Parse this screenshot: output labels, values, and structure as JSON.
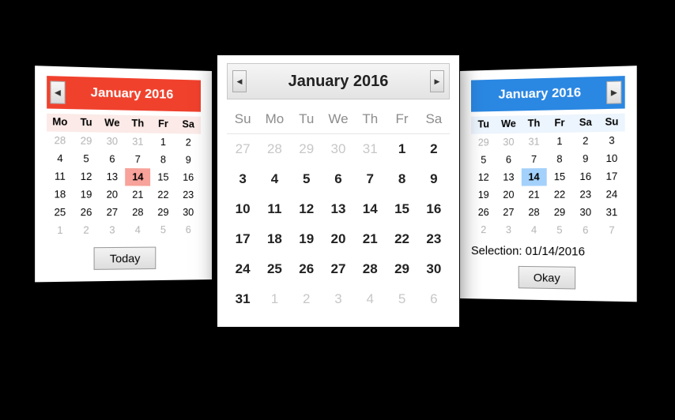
{
  "red": {
    "title": "January 2016",
    "weekdays": [
      "Mo",
      "Tu",
      "We",
      "Th",
      "Fr",
      "Sa"
    ],
    "rows": [
      [
        {
          "d": "28",
          "out": true
        },
        {
          "d": "29",
          "out": true
        },
        {
          "d": "30",
          "out": true
        },
        {
          "d": "31",
          "out": true
        },
        {
          "d": "1"
        },
        {
          "d": "2"
        }
      ],
      [
        {
          "d": "4"
        },
        {
          "d": "5"
        },
        {
          "d": "6"
        },
        {
          "d": "7"
        },
        {
          "d": "8"
        },
        {
          "d": "9"
        }
      ],
      [
        {
          "d": "11"
        },
        {
          "d": "12"
        },
        {
          "d": "13"
        },
        {
          "d": "14",
          "sel": true
        },
        {
          "d": "15"
        },
        {
          "d": "16"
        }
      ],
      [
        {
          "d": "18"
        },
        {
          "d": "19"
        },
        {
          "d": "20"
        },
        {
          "d": "21"
        },
        {
          "d": "22"
        },
        {
          "d": "23"
        }
      ],
      [
        {
          "d": "25"
        },
        {
          "d": "26"
        },
        {
          "d": "27"
        },
        {
          "d": "28"
        },
        {
          "d": "29"
        },
        {
          "d": "30"
        }
      ],
      [
        {
          "d": "1",
          "out": true
        },
        {
          "d": "2",
          "out": true
        },
        {
          "d": "3",
          "out": true
        },
        {
          "d": "4",
          "out": true
        },
        {
          "d": "5",
          "out": true
        },
        {
          "d": "6",
          "out": true
        }
      ]
    ],
    "today_button": "Today"
  },
  "gray": {
    "title": "January 2016",
    "weekdays": [
      "Su",
      "Mo",
      "Tu",
      "We",
      "Th",
      "Fr",
      "Sa"
    ],
    "rows": [
      [
        {
          "d": "27",
          "out": true
        },
        {
          "d": "28",
          "out": true
        },
        {
          "d": "29",
          "out": true
        },
        {
          "d": "30",
          "out": true
        },
        {
          "d": "31",
          "out": true
        },
        {
          "d": "1"
        },
        {
          "d": "2"
        }
      ],
      [
        {
          "d": "3"
        },
        {
          "d": "4"
        },
        {
          "d": "5"
        },
        {
          "d": "6"
        },
        {
          "d": "7"
        },
        {
          "d": "8"
        },
        {
          "d": "9"
        }
      ],
      [
        {
          "d": "10"
        },
        {
          "d": "11"
        },
        {
          "d": "12"
        },
        {
          "d": "13"
        },
        {
          "d": "14"
        },
        {
          "d": "15"
        },
        {
          "d": "16"
        }
      ],
      [
        {
          "d": "17"
        },
        {
          "d": "18"
        },
        {
          "d": "19"
        },
        {
          "d": "20"
        },
        {
          "d": "21"
        },
        {
          "d": "22"
        },
        {
          "d": "23"
        }
      ],
      [
        {
          "d": "24"
        },
        {
          "d": "25"
        },
        {
          "d": "26"
        },
        {
          "d": "27"
        },
        {
          "d": "28"
        },
        {
          "d": "29"
        },
        {
          "d": "30"
        }
      ],
      [
        {
          "d": "31"
        },
        {
          "d": "1",
          "out": true
        },
        {
          "d": "2",
          "out": true
        },
        {
          "d": "3",
          "out": true
        },
        {
          "d": "4",
          "out": true
        },
        {
          "d": "5",
          "out": true
        },
        {
          "d": "6",
          "out": true
        }
      ]
    ]
  },
  "blue": {
    "title": "January 2016",
    "weekdays": [
      "Tu",
      "We",
      "Th",
      "Fr",
      "Sa",
      "Su"
    ],
    "rows": [
      [
        {
          "d": "29",
          "out": true
        },
        {
          "d": "30",
          "out": true
        },
        {
          "d": "31",
          "out": true
        },
        {
          "d": "1"
        },
        {
          "d": "2"
        },
        {
          "d": "3"
        }
      ],
      [
        {
          "d": "5"
        },
        {
          "d": "6"
        },
        {
          "d": "7"
        },
        {
          "d": "8"
        },
        {
          "d": "9"
        },
        {
          "d": "10"
        }
      ],
      [
        {
          "d": "12"
        },
        {
          "d": "13"
        },
        {
          "d": "14",
          "sel": true
        },
        {
          "d": "15"
        },
        {
          "d": "16"
        },
        {
          "d": "17"
        }
      ],
      [
        {
          "d": "19"
        },
        {
          "d": "20"
        },
        {
          "d": "21"
        },
        {
          "d": "22"
        },
        {
          "d": "23"
        },
        {
          "d": "24"
        }
      ],
      [
        {
          "d": "26"
        },
        {
          "d": "27"
        },
        {
          "d": "28"
        },
        {
          "d": "29"
        },
        {
          "d": "30"
        },
        {
          "d": "31"
        }
      ],
      [
        {
          "d": "2",
          "out": true
        },
        {
          "d": "3",
          "out": true
        },
        {
          "d": "4",
          "out": true
        },
        {
          "d": "5",
          "out": true
        },
        {
          "d": "6",
          "out": true
        },
        {
          "d": "7",
          "out": true
        }
      ]
    ],
    "selection_text": "Selection: 01/14/2016",
    "okay_button": "Okay"
  }
}
